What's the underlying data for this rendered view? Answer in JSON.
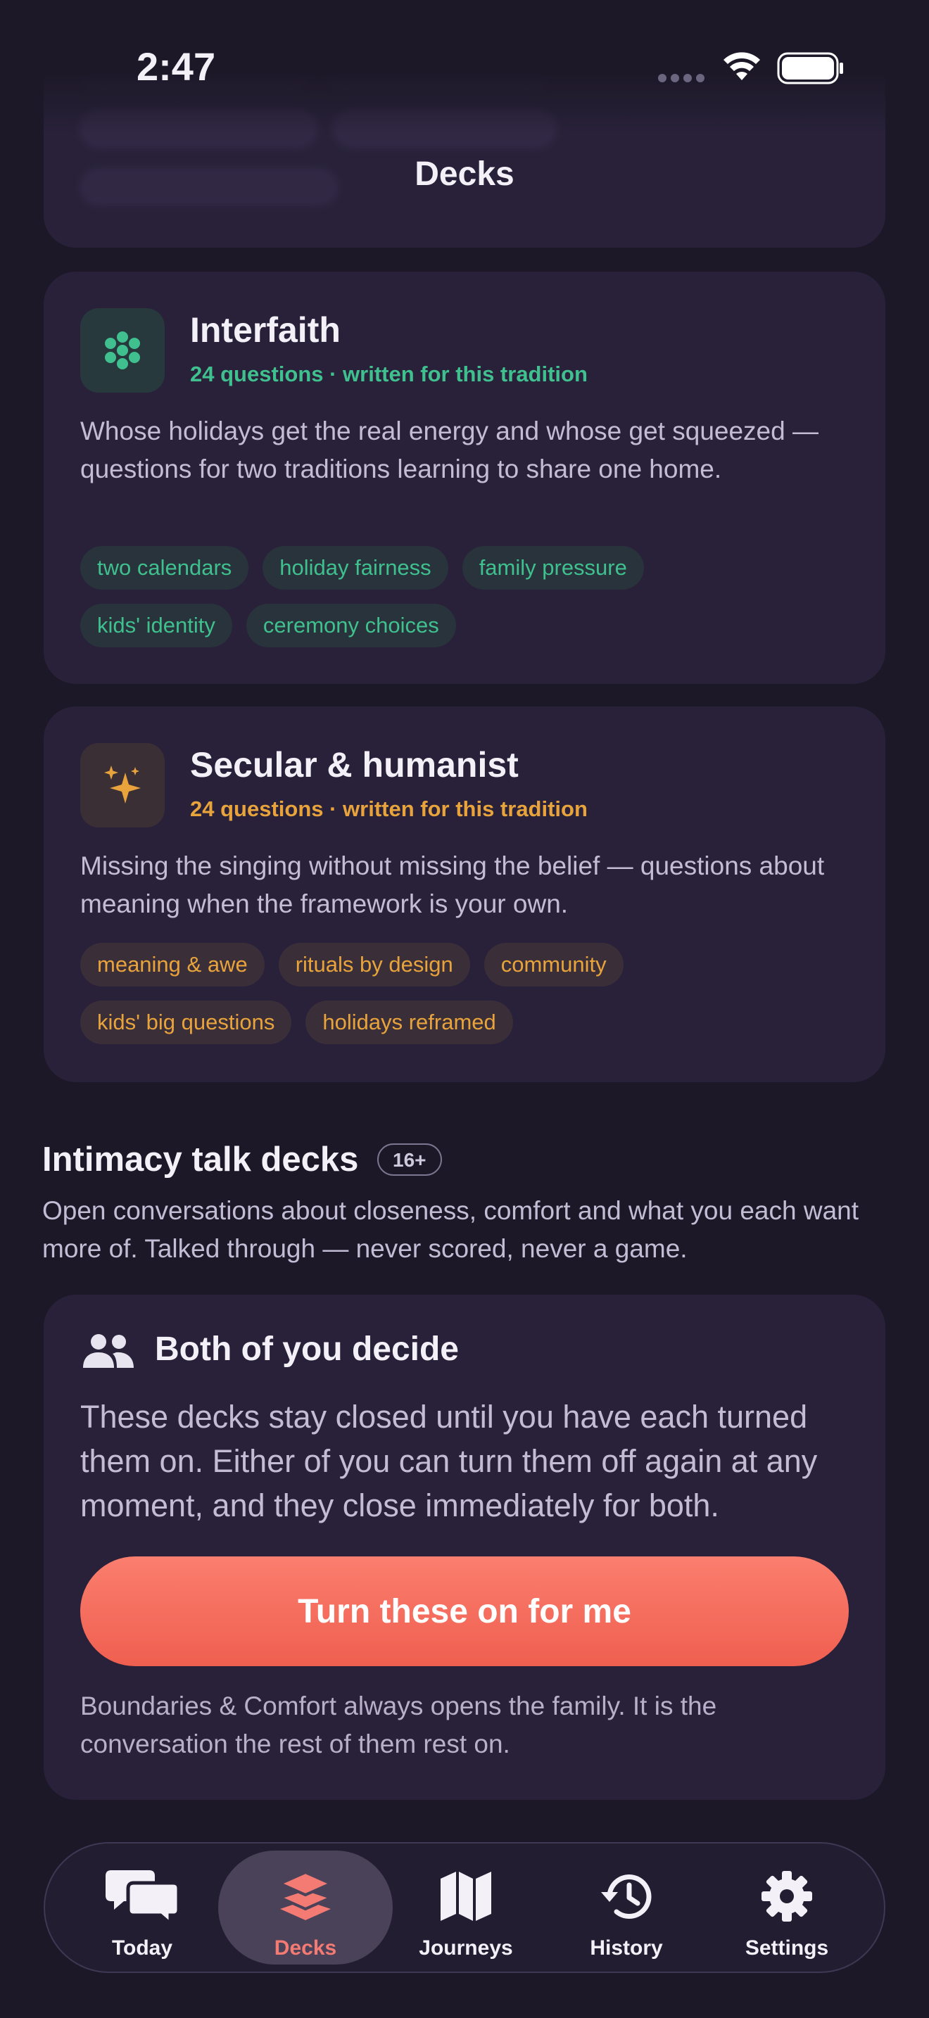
{
  "status_bar": {
    "time": "2:47"
  },
  "nav": {
    "title": "Decks"
  },
  "decks": [
    {
      "title": "Interfaith",
      "meta": "24 questions · written for this tradition",
      "description": "Whose holidays get the real energy and whose get squeezed — questions for two traditions learning to share one home.",
      "accent": "#3fc08e",
      "icon": "flower-icon",
      "tags": [
        "two calendars",
        "holiday fairness",
        "family pressure",
        "kids' identity",
        "ceremony choices"
      ]
    },
    {
      "title": "Secular & humanist",
      "meta": "24 questions · written for this tradition",
      "description": "Missing the singing without missing the belief — questions about meaning when the framework is your own.",
      "accent": "#e8a33c",
      "icon": "sparkles-icon",
      "tags": [
        "meaning & awe",
        "rituals by design",
        "community",
        "kids' big questions",
        "holidays reframed"
      ]
    }
  ],
  "intimacy": {
    "title": "Intimacy talk decks",
    "badge": "16+",
    "description": "Open conversations about closeness, comfort and what you each want more of. Talked through — never scored, never a game.",
    "consent": {
      "title": "Both of you decide",
      "body": "These decks stay closed until you have each turned them on. Either of you can turn them off again at any moment, and they close immediately for both.",
      "button": "Turn these on for me",
      "footnote": "Boundaries & Comfort always opens the family. It is the conversation the rest of them rest on."
    }
  },
  "tabbar": {
    "tabs": [
      {
        "label": "Today",
        "icon": "chat-bubbles-icon",
        "active": false
      },
      {
        "label": "Decks",
        "icon": "layers-icon",
        "active": true
      },
      {
        "label": "Journeys",
        "icon": "map-icon",
        "active": false
      },
      {
        "label": "History",
        "icon": "history-icon",
        "active": false
      },
      {
        "label": "Settings",
        "icon": "gear-icon",
        "active": false
      }
    ]
  },
  "colors": {
    "accent_coral": "#f47a74",
    "background": "#1d1828",
    "card": "#282139"
  }
}
